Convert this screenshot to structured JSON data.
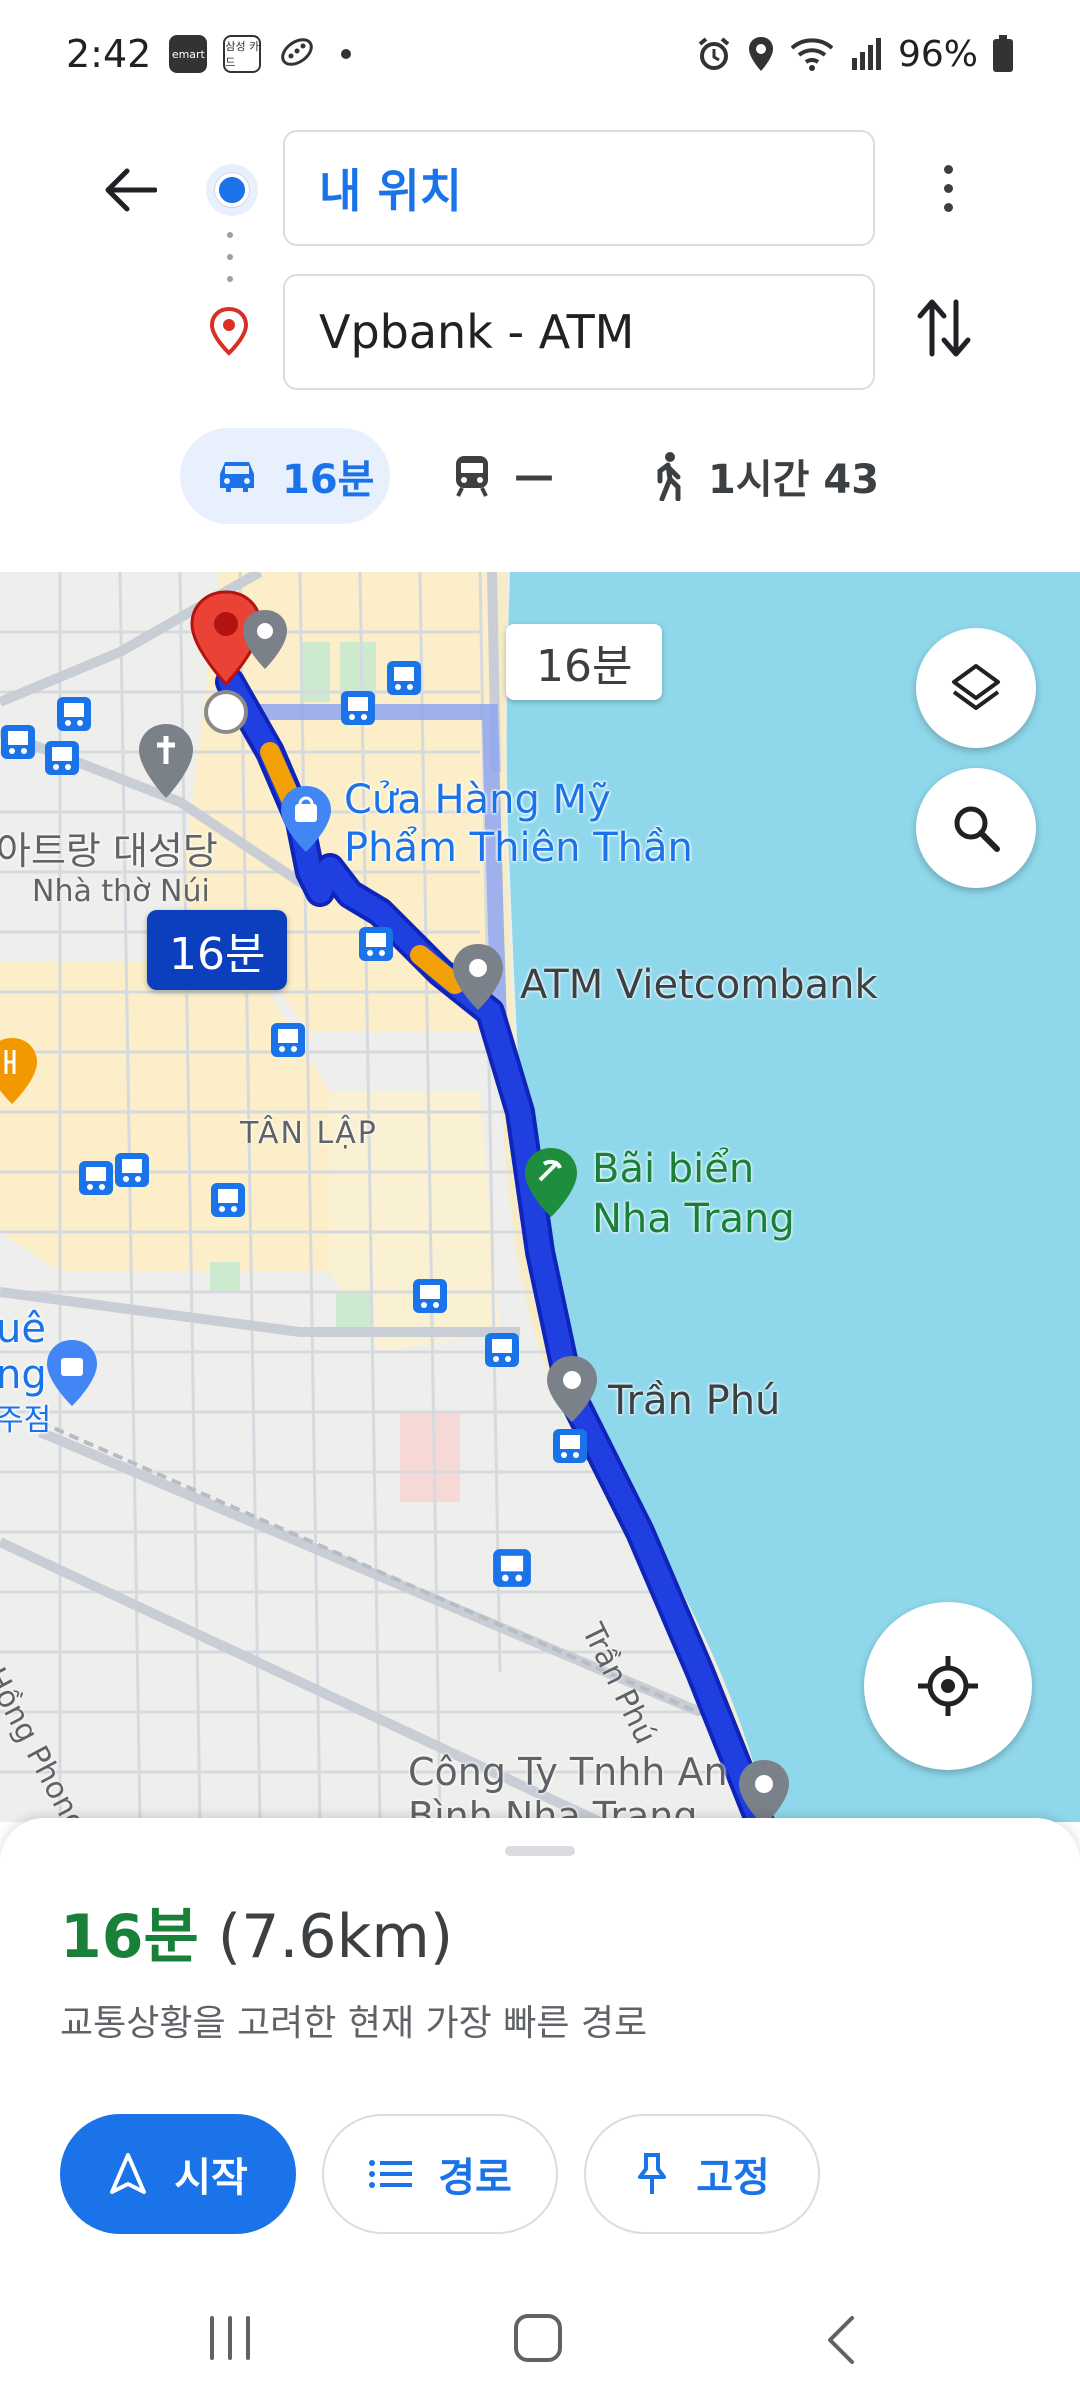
{
  "status_bar": {
    "time": "2:42",
    "notif_emart": "emart",
    "notif_samsung": "삼성 카드",
    "battery": "96%"
  },
  "header": {
    "origin": "내 위치",
    "destination": "Vpbank - ATM"
  },
  "modes": {
    "drive": "16분",
    "transit": "—",
    "walk": "1시간 43"
  },
  "map": {
    "alt_route_time": "16분",
    "route_time": "16분",
    "labels": {
      "shop_line1": "Cửa Hàng Mỹ",
      "shop_line2": "Phẩm Thiên Thần",
      "church_kr": "아트랑 대성당",
      "church_vn": "Nhà thờ Núi",
      "atm": "ATM Vietcombank",
      "beach_line1": "Bãi biển",
      "beach_line2": "Nha Trang",
      "area": "TÂN LẬP",
      "tran_phu": "Trần Phú",
      "road_tran_phu": "Trần Phú",
      "company_line1": "Công Ty Tnhh An",
      "company_line2": "Bình Nha Trang",
      "left_line1": "uê",
      "left_line2": "ng",
      "left_line3": "주점",
      "road_left": "Hồng Phong"
    }
  },
  "sheet": {
    "duration": "16분",
    "distance": "(7.6km)",
    "description": "교통상황을 고려한 현재 가장 빠른 경로",
    "start": "시작",
    "steps": "경로",
    "pin": "고정"
  },
  "colors": {
    "accent": "#1a73e8",
    "route": "#1f3fe0",
    "sea": "#8fd8eb",
    "duration_green": "#188038"
  }
}
